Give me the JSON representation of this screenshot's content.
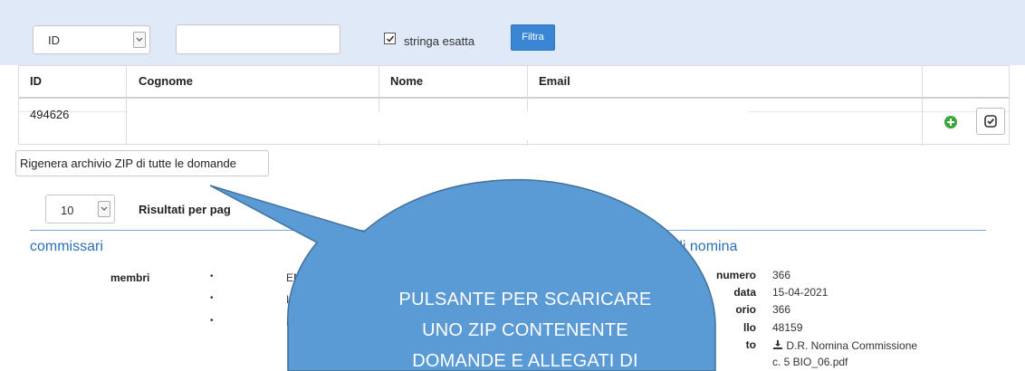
{
  "filter": {
    "field_select_value": "ID",
    "search_value": "",
    "exact_match_label": "stringa esatta",
    "exact_match_checked": true,
    "filter_button": "Filtra"
  },
  "table": {
    "headers": [
      "ID",
      "Cognome",
      "Nome",
      "Email"
    ],
    "rows": [
      {
        "id": "494626"
      }
    ]
  },
  "zip_button": "Rigenera archivio ZIP di tutte le domande",
  "pager": {
    "page_size": "10",
    "results_label": "Risultati per pag"
  },
  "commissari": {
    "title": "commissari",
    "members_label": "membri",
    "members": [
      "EN",
      "I (I",
      "F"
    ]
  },
  "nomina": {
    "title": "di nomina",
    "fields": [
      {
        "label": "numero",
        "value": "366"
      },
      {
        "label": "data",
        "value": "15-04-2021"
      },
      {
        "label": "orio",
        "value": "366"
      },
      {
        "label": "llo",
        "value": "48159"
      }
    ],
    "attachment_label": "to",
    "attachment_value": "D.R. Nomina Commissione c. 5 BIO_06.pdf"
  },
  "callout": {
    "line1": "PULSANTE PER SCARICARE",
    "line2": "UNO ZIP CONTENENTE",
    "line3": "DOMANDE E ALLEGATI DI"
  },
  "colors": {
    "filter_bg": "#dfe9f7",
    "primary_button": "#3a86d4",
    "callout_fill": "#5b9bd5",
    "callout_border": "#41719c",
    "section_title": "#2c6fb6",
    "add_icon": "#3aa53a"
  }
}
